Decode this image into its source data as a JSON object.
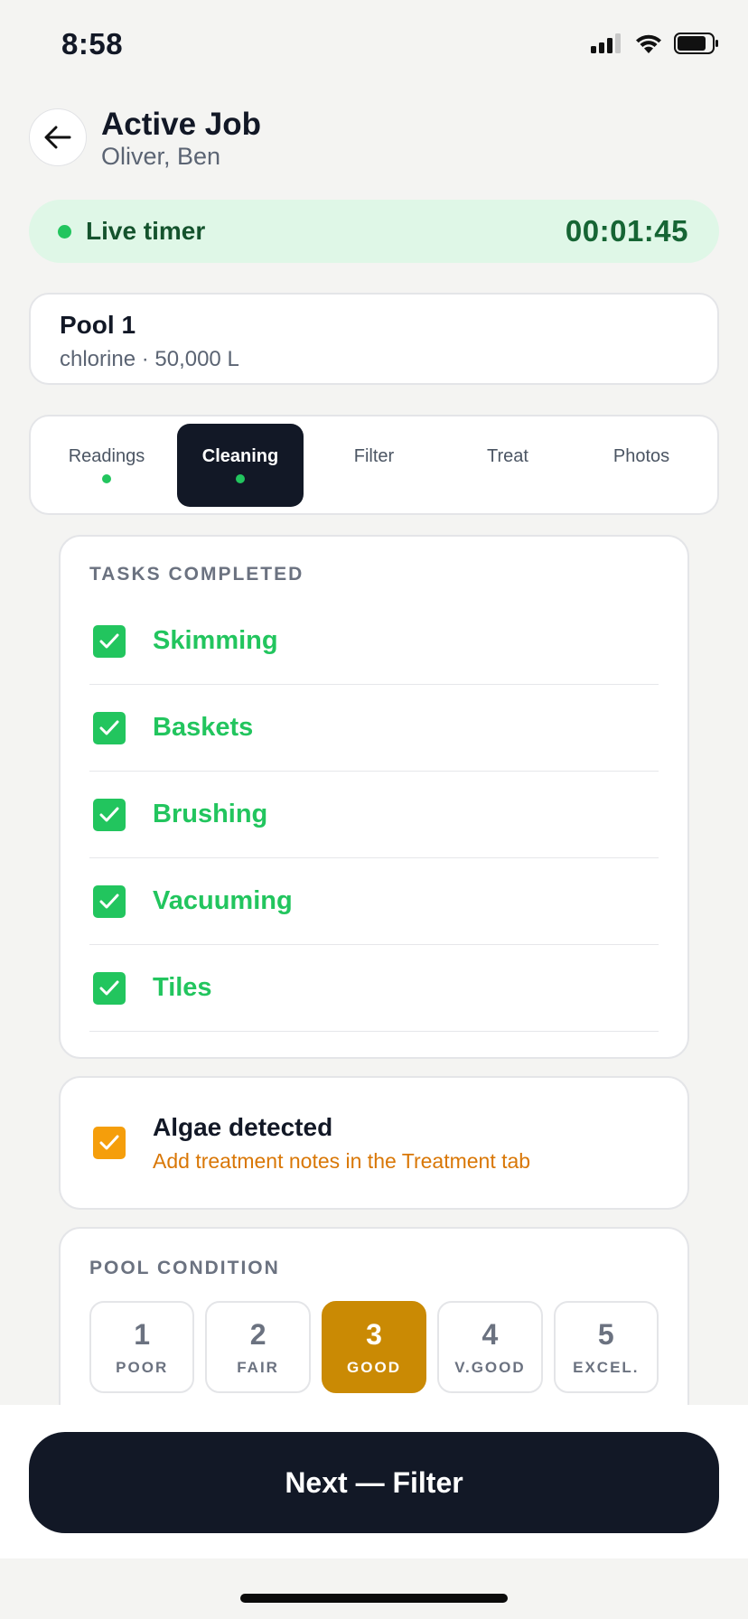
{
  "status_bar": {
    "time": "8:58"
  },
  "header": {
    "title": "Active Job",
    "subtitle": "Oliver, Ben"
  },
  "timer": {
    "label": "Live timer",
    "value": "00:01:45"
  },
  "pool": {
    "name": "Pool 1",
    "meta": "chlorine · 50,000 L"
  },
  "tabs": [
    {
      "label": "Readings",
      "done": true,
      "active": false
    },
    {
      "label": "Cleaning",
      "done": true,
      "active": true
    },
    {
      "label": "Filter",
      "done": false,
      "active": false
    },
    {
      "label": "Treat",
      "done": false,
      "active": false
    },
    {
      "label": "Photos",
      "done": false,
      "active": false
    }
  ],
  "tasks": {
    "heading": "TASKS COMPLETED",
    "items": [
      {
        "label": "Skimming",
        "checked": true
      },
      {
        "label": "Baskets",
        "checked": true
      },
      {
        "label": "Brushing",
        "checked": true
      },
      {
        "label": "Vacuuming",
        "checked": true
      },
      {
        "label": "Tiles",
        "checked": true
      }
    ]
  },
  "algae": {
    "title": "Algae detected",
    "note": "Add treatment notes in the Treatment tab",
    "checked": true
  },
  "condition": {
    "heading": "POOL CONDITION",
    "selected": 3,
    "options": [
      {
        "num": "1",
        "word": "POOR"
      },
      {
        "num": "2",
        "word": "FAIR"
      },
      {
        "num": "3",
        "word": "GOOD"
      },
      {
        "num": "4",
        "word": "V.GOOD"
      },
      {
        "num": "5",
        "word": "EXCEL."
      }
    ]
  },
  "footer": {
    "next_label": "Next — Filter"
  },
  "colors": {
    "accent_green": "#22c55e",
    "dark": "#121826",
    "warning": "#f59e0b",
    "selected_rating": "#ca8a04"
  }
}
